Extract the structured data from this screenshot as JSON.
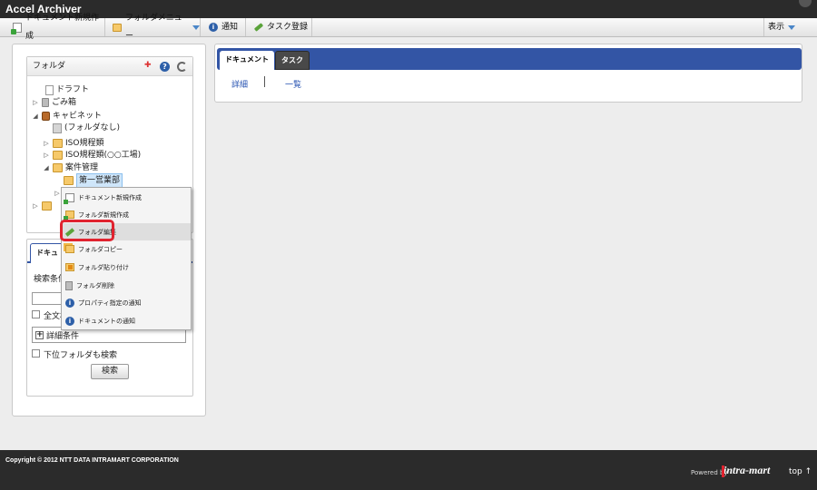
{
  "app": {
    "title": "Accel Archiver"
  },
  "toolbar": {
    "new_document": "ドキュメント新規作成",
    "folder_menu": "フォルダメニュー",
    "notify": "通知",
    "task_register": "タスク登録",
    "display": "表示"
  },
  "folder_panel": {
    "title": "フォルダ",
    "tree": {
      "draft": "ドラフト",
      "trash": "ごみ箱",
      "cabinet": "キャビネット",
      "no_folder": "(フォルダなし)",
      "iso": "ISO規程類",
      "iso_factory": "ISO規程類(○○工場)",
      "case_mgmt": "案件管理",
      "sales1": "第一営業部"
    }
  },
  "context_menu": {
    "items": [
      "ドキュメント新規作成",
      "フォルダ新規作成",
      "フォルダ編集",
      "フォルダコピー",
      "フォルダ貼り付け",
      "フォルダ削除",
      "プロパティ指定の通知",
      "ドキュメントの通知"
    ]
  },
  "search_panel": {
    "tab": "ドキュ",
    "condition_label": "検索条件",
    "fulltext_label": "全文検",
    "detail_label": "詳細条件",
    "subfolder_label": "下位フォルダも検索",
    "search_button": "検索"
  },
  "main": {
    "tabs": [
      "ドキュメント",
      "タスク"
    ],
    "links": [
      "詳細",
      "一覧"
    ]
  },
  "footer": {
    "copyright": "Copyright © 2012 NTT DATA INTRAMART CORPORATION",
    "powered_by": "Powered by",
    "logo": "intra-mart",
    "top": "top ↑"
  }
}
